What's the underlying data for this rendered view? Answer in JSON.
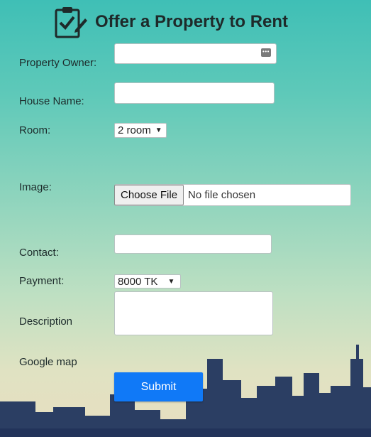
{
  "header": {
    "title": "Offer a Property to Rent",
    "icon": "clipboard-check-icon"
  },
  "form": {
    "owner": {
      "label": "Property Owner:",
      "value": ""
    },
    "house": {
      "label": "House Name:",
      "value": ""
    },
    "room": {
      "label": "Room:",
      "selected": "2 room"
    },
    "image": {
      "label": "Image:",
      "button": "Choose File",
      "status": "No file chosen"
    },
    "contact": {
      "label": "Contact:",
      "value": ""
    },
    "payment": {
      "label": "Payment:",
      "selected": "8000 TK"
    },
    "description": {
      "label": "Description",
      "value": ""
    },
    "map": {
      "label": "Google map"
    },
    "submit": "Submit"
  },
  "colors": {
    "accent": "#1079f7",
    "sky_top": "#3fbfb6",
    "sky_bottom": "#e8dec0",
    "skyline": "#2b3e63"
  }
}
